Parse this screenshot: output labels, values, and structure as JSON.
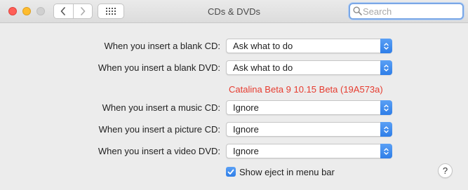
{
  "window": {
    "title": "CDs & DVDs"
  },
  "toolbar": {
    "back_icon": "chevron-left-icon",
    "forward_icon": "chevron-right-icon",
    "grid_icon": "show-all-grid-icon",
    "search_placeholder": "Search",
    "search_value": ""
  },
  "settings": [
    {
      "label": "When you insert a blank CD:",
      "value": "Ask what to do"
    },
    {
      "label": "When you insert a blank DVD:",
      "value": "Ask what to do"
    },
    {
      "label": "When you insert a music CD:",
      "value": "Ignore"
    },
    {
      "label": "When you insert a picture CD:",
      "value": "Ignore"
    },
    {
      "label": "When you insert a video DVD:",
      "value": "Ignore"
    }
  ],
  "banner": {
    "text": "Catalina Beta 9 10.15 Beta (19A573a)",
    "color": "#e63b2f"
  },
  "eject": {
    "label": "Show eject in menu bar",
    "checked": true
  },
  "help": {
    "label": "?"
  },
  "colors": {
    "accent": "#2f7ee8",
    "close": "#ff5f57",
    "minimize": "#febc2e"
  }
}
